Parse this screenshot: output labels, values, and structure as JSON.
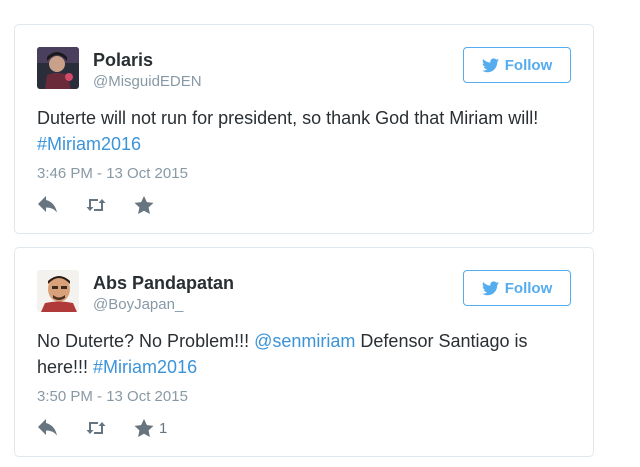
{
  "tweets": [
    {
      "name": "Polaris",
      "handle": "@MisguidEDEN",
      "follow_label": "Follow",
      "text_parts": [
        "Duterte will not run for president, so thank God that Miriam will!",
        "#Miriam2016"
      ],
      "timestamp": "3:46 PM - 13 Oct 2015",
      "favorite_count": ""
    },
    {
      "name": "Abs Pandapatan",
      "handle": "@BoyJapan_",
      "follow_label": "Follow",
      "text_parts": [
        "No Duterte? No Problem!!!",
        "@senmiriam",
        "Defensor Santiago is",
        "here!!!",
        "#Miriam2016"
      ],
      "timestamp": "3:50 PM - 13 Oct 2015",
      "favorite_count": "1"
    }
  ],
  "icons": [
    "twitter-bird-icon",
    "reply-icon",
    "retweet-icon",
    "favorite-star-icon"
  ],
  "colors": {
    "link": "#3b94d9",
    "follow": "#55acee",
    "muted": "#8899a6",
    "text": "#292f33"
  }
}
